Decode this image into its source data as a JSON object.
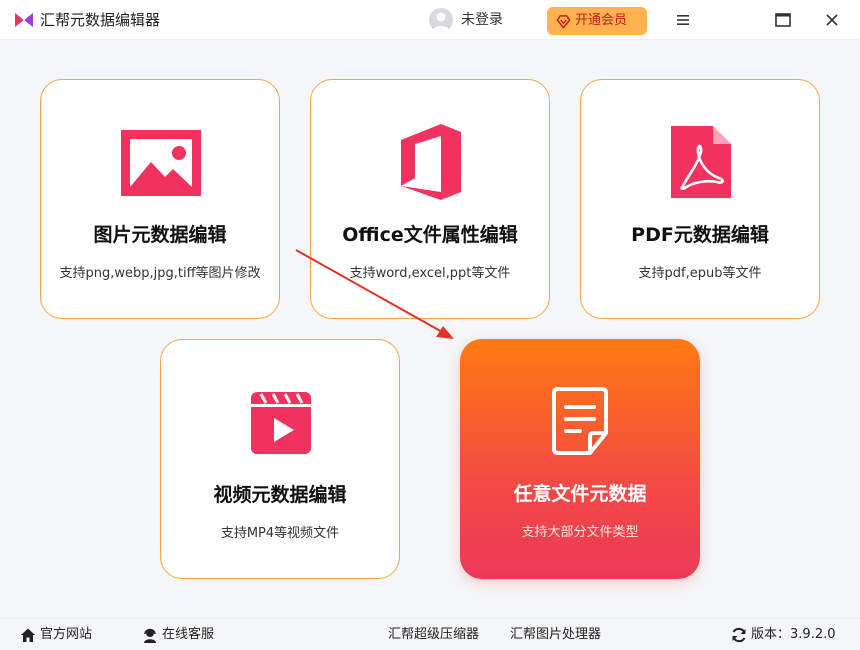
{
  "app": {
    "title": "汇帮元数据编辑器"
  },
  "header": {
    "login_text": "未登录",
    "vip_label": "开通会员"
  },
  "colors": {
    "accent": "#f0325f",
    "card_border": "#f0a94e",
    "vip_bg": "#ffb24d",
    "arrow": "#e8302a"
  },
  "cards": [
    {
      "title": "图片元数据编辑",
      "desc": "支持png,webp,jpg,tiff等图片修改",
      "icon": "image-icon"
    },
    {
      "title": "Office文件属性编辑",
      "desc": "支持word,excel,ppt等文件",
      "icon": "office-icon"
    },
    {
      "title": "PDF元数据编辑",
      "desc": "支持pdf,epub等文件",
      "icon": "pdf-icon"
    },
    {
      "title": "视频元数据编辑",
      "desc": "支持MP4等视频文件",
      "icon": "video-icon"
    },
    {
      "title": "任意文件元数据",
      "desc": "支持大部分文件类型",
      "icon": "document-icon",
      "selected": true
    }
  ],
  "footer": {
    "website": "官方网站",
    "support": "在线客服",
    "compressor": "汇帮超级压缩器",
    "image_tool": "汇帮图片处理器",
    "version_label": "版本：",
    "version": "3.9.2.0"
  }
}
